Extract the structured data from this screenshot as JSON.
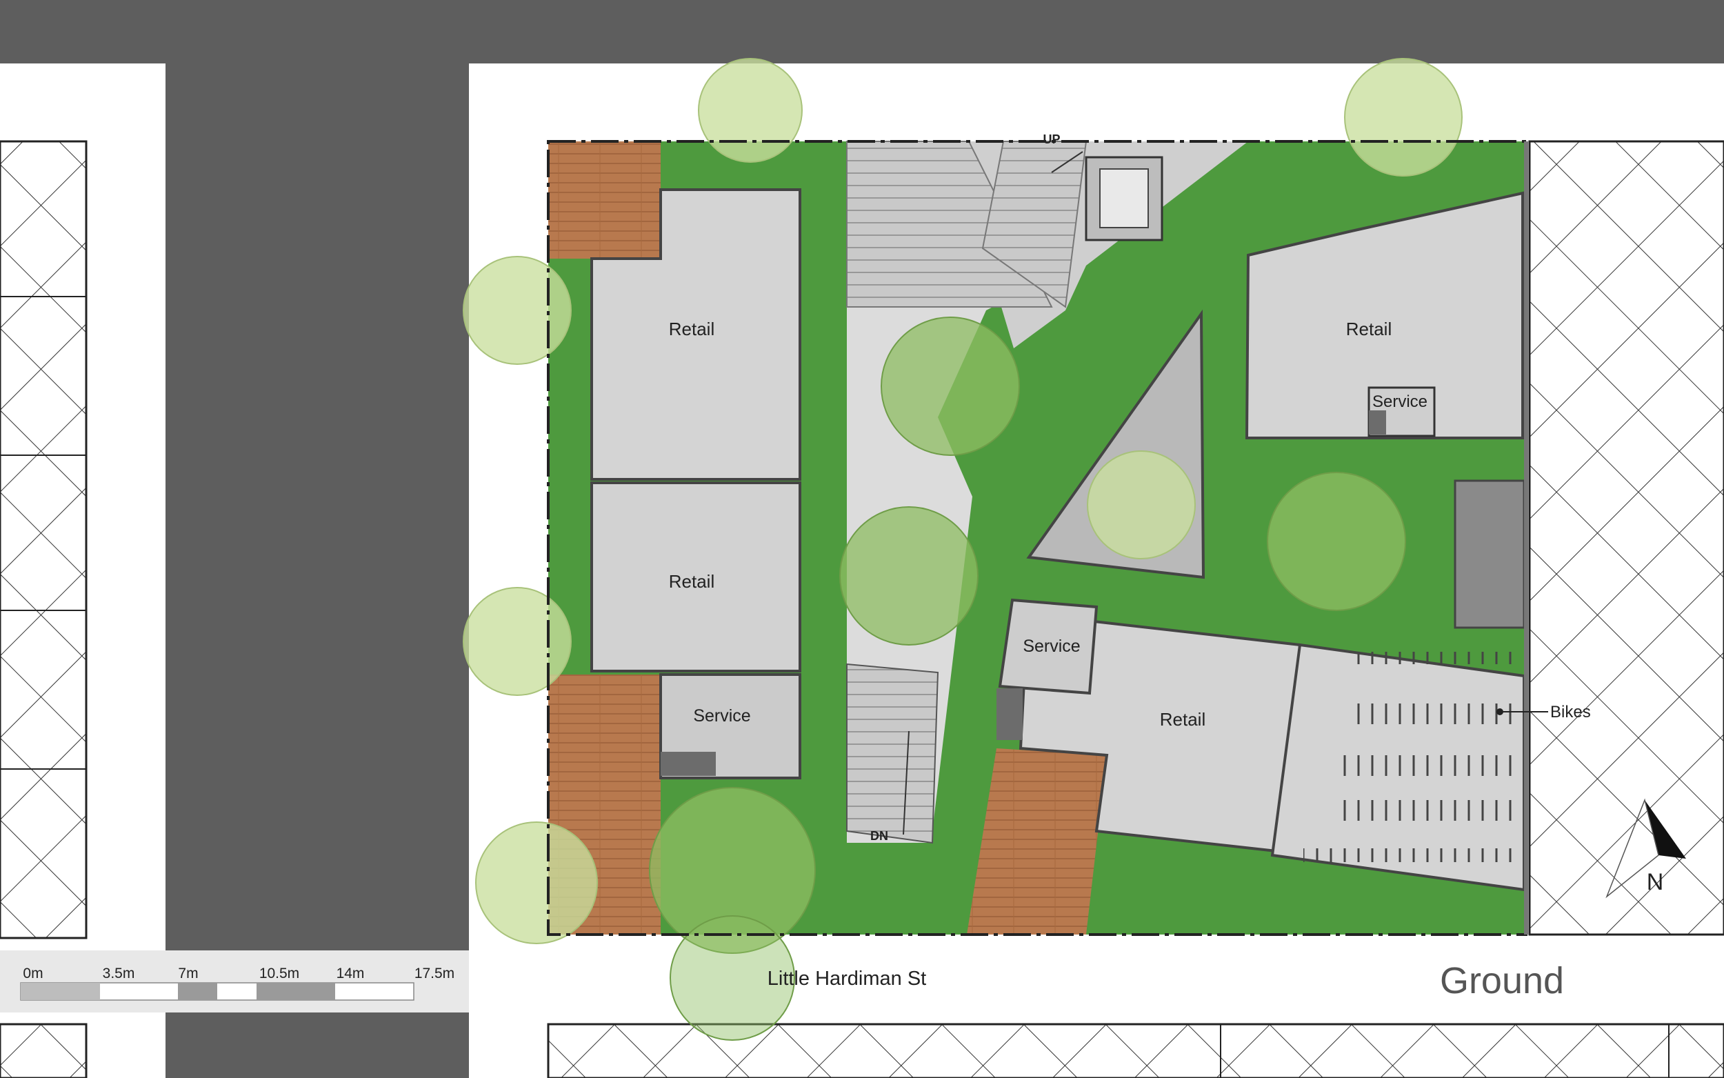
{
  "rooms": {
    "retail_nw": "Retail",
    "retail_w": "Retail",
    "retail_ne": "Retail",
    "retail_se": "Retail",
    "service_w": "Service",
    "service_ne": "Service",
    "service_c": "Service"
  },
  "annotations": {
    "stair_up": "UP",
    "stair_down": "DN",
    "bikes": "Bikes",
    "north": "N"
  },
  "street_name": "Little Hardiman St",
  "drawing_title": "Ground",
  "scale_bar": {
    "ticks": [
      "0m",
      "3.5m",
      "7m",
      "10.5m",
      "14m",
      "17.5m"
    ]
  },
  "colors": {
    "road": "#5e5e5e",
    "sidewalk": "#ffffff",
    "lawn": "#4e9a3e",
    "concrete": "#d4d4d4",
    "timber_deck": "#b8794e",
    "tree_canopy": "#c9df9e"
  }
}
